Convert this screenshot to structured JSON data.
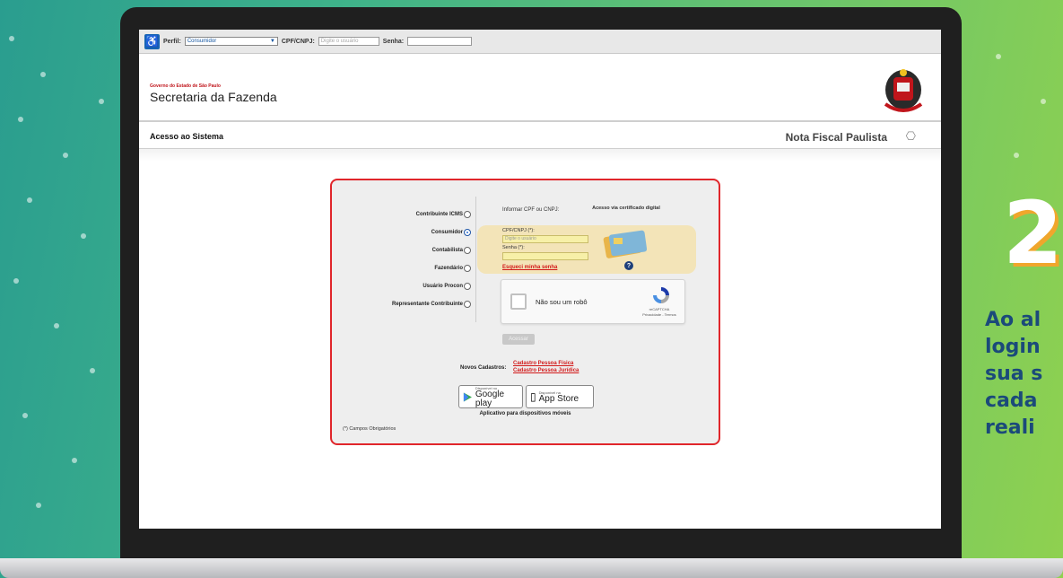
{
  "topbar": {
    "perfil_label": "Perfil:",
    "perfil_value": "Consumidor",
    "cpf_label": "CPF/CNPJ:",
    "cpf_placeholder": "Digite o usuário",
    "senha_label": "Senha:"
  },
  "header": {
    "gov_small": "Governo do Estado de São Paulo",
    "title": "Secretaria da Fazenda"
  },
  "bar": {
    "left_title": "Acesso ao Sistema",
    "right_title": "Nota Fiscal Paulista"
  },
  "login": {
    "profiles": [
      {
        "label": "Contribuinte ICMS",
        "selected": false
      },
      {
        "label": "Consumidor",
        "selected": true
      },
      {
        "label": "Contabilista",
        "selected": false
      },
      {
        "label": "Fazendário",
        "selected": false
      },
      {
        "label": "Usuário Procon",
        "selected": false
      },
      {
        "label": "Representante Contribuinte",
        "selected": false
      }
    ],
    "inform_text": "Informar CPF ou CNPJ:",
    "cert_text": "Acesso via certificado digital",
    "cpf_label": "CPF/CNPJ (*):",
    "cpf_placeholder": "Digite o usuário",
    "senha_label": "Senha (*):",
    "forgot": "Esqueci minha senha",
    "captcha_text": "Não sou um robô",
    "captcha_brand": "reCAPTCHA",
    "captcha_links": "Privacidade - Termos",
    "acessar": "Acessar",
    "novos_label": "Novos Cadastros:",
    "cadastro_pf": "Cadastro Pessoa Física",
    "cadastro_pj": "Cadastro Pessoa Jurídica",
    "google_small": "Disponível no",
    "google_big": "Google play",
    "apple_small": "Disponível na",
    "apple_big": "App Store",
    "apps_caption": "Aplicativo para dispositivos móveis",
    "campos": "(*) Campos Obrigatórios"
  },
  "side": {
    "step": "2",
    "lines": [
      "Ao al",
      "login",
      "sua s",
      "cada",
      "reali"
    ]
  },
  "colors": {
    "accent_red": "#e0262b",
    "link_red": "#d21a1a",
    "side_text": "#1b4a7a",
    "step_shadow": "#f0a62c"
  }
}
